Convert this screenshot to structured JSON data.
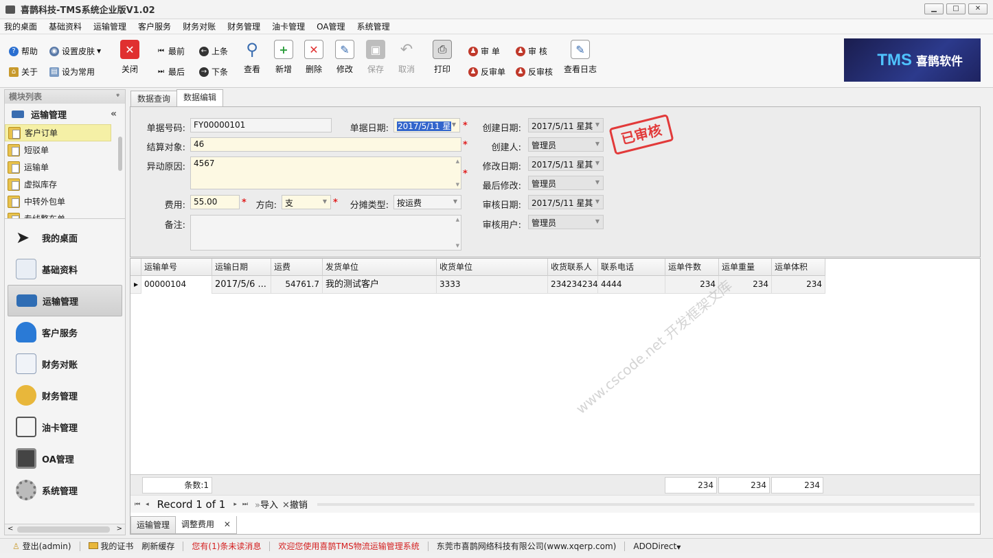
{
  "window": {
    "title": "喜鹊科技-TMS系统企业版V1.02",
    "minimize": "▁",
    "maximize": "□",
    "close": "✕"
  },
  "menu": [
    "我的桌面",
    "基础资料",
    "运输管理",
    "客户服务",
    "财务对账",
    "财务管理",
    "油卡管理",
    "OA管理",
    "系统管理"
  ],
  "toolbar": {
    "help": "帮助",
    "skin": "设置皮肤",
    "about": "关于",
    "set_common": "设为常用",
    "close": "关闭",
    "first": "最前",
    "prev": "上条",
    "last": "最后",
    "next": "下条",
    "view": "查看",
    "add": "新增",
    "delete": "删除",
    "edit": "修改",
    "save": "保存",
    "cancel": "取消",
    "print": "打印",
    "audit_doc": "审 单",
    "review": "审 核",
    "unaudit_doc": "反审单",
    "unreview": "反审核",
    "view_log": "查看日志",
    "banner_tms": "TMS",
    "banner_name": "喜鹊软件"
  },
  "sidebar": {
    "header": "模块列表",
    "pin": "ᵠ",
    "group": "运输管理",
    "collapse": "«",
    "items": [
      "客户订单",
      "短驳单",
      "运输单",
      "虚拟库存",
      "中转外包单",
      "专线整车单"
    ],
    "nav": [
      "我的桌面",
      "基础资料",
      "运输管理",
      "客户服务",
      "财务对账",
      "财务管理",
      "油卡管理",
      "OA管理",
      "系统管理"
    ],
    "scroll_left": "<",
    "scroll_right": ">"
  },
  "tabs_top": [
    "数据查询",
    "数据编辑"
  ],
  "form": {
    "doc_no_label": "单据号码:",
    "doc_no": "FY00000101",
    "doc_date_label": "单据日期:",
    "doc_date": "2017/5/11 星",
    "create_date_label": "创建日期:",
    "create_date": "2017/5/11 星其",
    "settle_label": "结算对象:",
    "settle": "46",
    "creator_label": "创建人:",
    "creator": "管理员",
    "reason_label": "异动原因:",
    "reason": "4567",
    "modify_date_label": "修改日期:",
    "modify_date": "2017/5/11 星其",
    "last_modifier_label": "最后修改:",
    "last_modifier": "管理员",
    "fee_label": "费用:",
    "fee": "55.00",
    "direction_label": "方向:",
    "direction": "支",
    "split_label": "分摊类型:",
    "split": "按运费",
    "audit_date_label": "审核日期:",
    "audit_date": "2017/5/11 星其",
    "remark_label": "备注:",
    "remark": "",
    "audit_user_label": "审核用户:",
    "audit_user": "管理员",
    "stamp": "已审核",
    "required_mark": "*"
  },
  "grid": {
    "columns": [
      "运输单号",
      "运输日期",
      "运费",
      "发货单位",
      "收货单位",
      "收货联系人",
      "联系电话",
      "运单件数",
      "运单重量",
      "运单体积"
    ],
    "rows": [
      [
        "00000104",
        "2017/5/6 ...",
        "54761.7",
        "我的测试客户",
        "3333",
        "234234234",
        "4444",
        "234",
        "234",
        "234"
      ]
    ],
    "footer_count": "条数:1",
    "footer_sum1": "234",
    "footer_sum2": "234",
    "footer_sum3": "234"
  },
  "pager": {
    "first": "⏮",
    "prev": "◂",
    "record": "Record 1 of 1",
    "next": "▸",
    "last": "⏭",
    "import": "导入",
    "cancel": "撤销"
  },
  "tabs_bottom": [
    "运输管理",
    "调整费用"
  ],
  "status": {
    "logout": "登出(admin)",
    "cert": "我的证书",
    "refresh": "刷新缓存",
    "unread": "您有(1)条未读消息",
    "welcome": "欢迎您使用喜鹊TMS物流运输管理系统",
    "company": "东莞市喜鹊网络科技有限公司(www.xqerp.com)",
    "ado": "ADODirect"
  },
  "watermark": "www.cscode.net 开发框架文库"
}
